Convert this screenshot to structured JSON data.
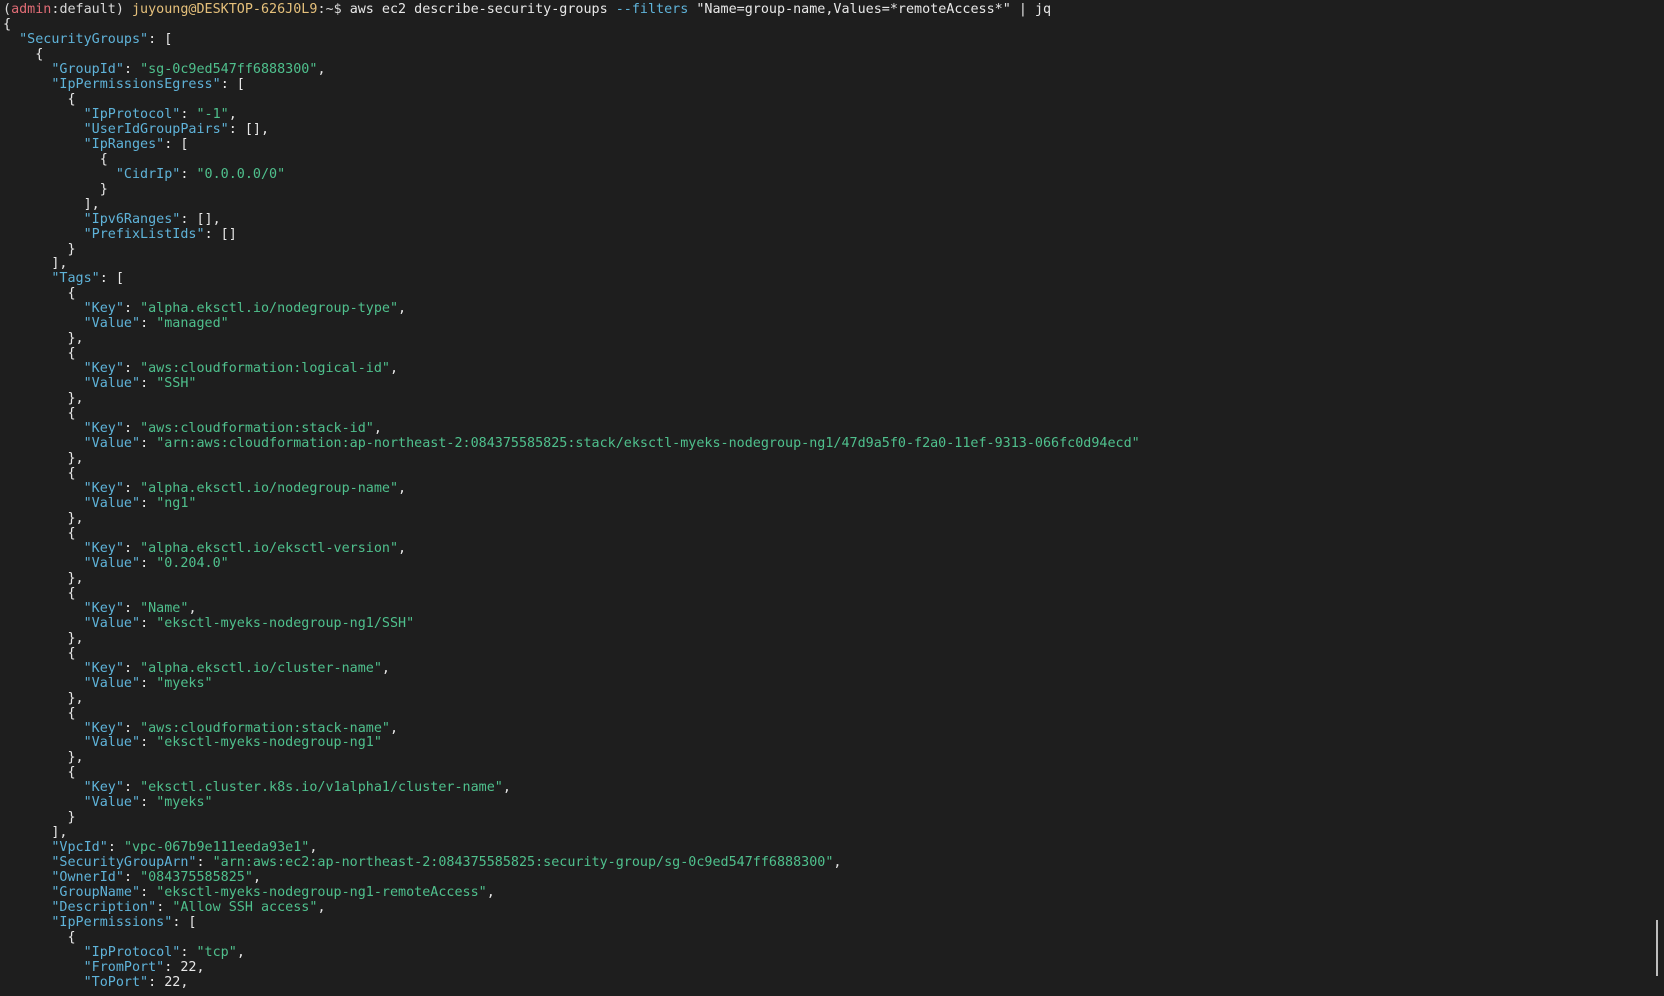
{
  "prompt": {
    "open_paren": "(",
    "env": "admin",
    "colon": ":",
    "profile": "default",
    "close_paren": ")",
    "user_host": "juyoung@DESKTOP-626J0L9",
    "path": ":~",
    "dollar": "$",
    "cmd_main": "aws ec2 describe-security-groups",
    "cmd_flag": "--filters",
    "cmd_arg": "\"Name=group-name,Values=*remoteAccess*\"",
    "cmd_pipe": "| jq"
  },
  "output_lines": [
    [
      [
        "w",
        "{"
      ]
    ],
    [
      [
        "w",
        "  "
      ],
      [
        "k",
        "\"SecurityGroups\""
      ],
      [
        "w",
        ": ["
      ]
    ],
    [
      [
        "w",
        "    {"
      ]
    ],
    [
      [
        "w",
        "      "
      ],
      [
        "k",
        "\"GroupId\""
      ],
      [
        "w",
        ": "
      ],
      [
        "s",
        "\"sg-0c9ed547ff6888300\""
      ],
      [
        "w",
        ","
      ]
    ],
    [
      [
        "w",
        "      "
      ],
      [
        "k",
        "\"IpPermissionsEgress\""
      ],
      [
        "w",
        ": ["
      ]
    ],
    [
      [
        "w",
        "        {"
      ]
    ],
    [
      [
        "w",
        "          "
      ],
      [
        "k",
        "\"IpProtocol\""
      ],
      [
        "w",
        ": "
      ],
      [
        "s",
        "\"-1\""
      ],
      [
        "w",
        ","
      ]
    ],
    [
      [
        "w",
        "          "
      ],
      [
        "k",
        "\"UserIdGroupPairs\""
      ],
      [
        "w",
        ": [],"
      ]
    ],
    [
      [
        "w",
        "          "
      ],
      [
        "k",
        "\"IpRanges\""
      ],
      [
        "w",
        ": ["
      ]
    ],
    [
      [
        "w",
        "            {"
      ]
    ],
    [
      [
        "w",
        "              "
      ],
      [
        "k",
        "\"CidrIp\""
      ],
      [
        "w",
        ": "
      ],
      [
        "s",
        "\"0.0.0.0/0\""
      ]
    ],
    [
      [
        "w",
        "            }"
      ]
    ],
    [
      [
        "w",
        "          ],"
      ]
    ],
    [
      [
        "w",
        "          "
      ],
      [
        "k",
        "\"Ipv6Ranges\""
      ],
      [
        "w",
        ": [],"
      ]
    ],
    [
      [
        "w",
        "          "
      ],
      [
        "k",
        "\"PrefixListIds\""
      ],
      [
        "w",
        ": []"
      ]
    ],
    [
      [
        "w",
        "        }"
      ]
    ],
    [
      [
        "w",
        "      ],"
      ]
    ],
    [
      [
        "w",
        "      "
      ],
      [
        "k",
        "\"Tags\""
      ],
      [
        "w",
        ": ["
      ]
    ],
    [
      [
        "w",
        "        {"
      ]
    ],
    [
      [
        "w",
        "          "
      ],
      [
        "k",
        "\"Key\""
      ],
      [
        "w",
        ": "
      ],
      [
        "s",
        "\"alpha.eksctl.io/nodegroup-type\""
      ],
      [
        "w",
        ","
      ]
    ],
    [
      [
        "w",
        "          "
      ],
      [
        "k",
        "\"Value\""
      ],
      [
        "w",
        ": "
      ],
      [
        "s",
        "\"managed\""
      ]
    ],
    [
      [
        "w",
        "        },"
      ]
    ],
    [
      [
        "w",
        "        {"
      ]
    ],
    [
      [
        "w",
        "          "
      ],
      [
        "k",
        "\"Key\""
      ],
      [
        "w",
        ": "
      ],
      [
        "s",
        "\"aws:cloudformation:logical-id\""
      ],
      [
        "w",
        ","
      ]
    ],
    [
      [
        "w",
        "          "
      ],
      [
        "k",
        "\"Value\""
      ],
      [
        "w",
        ": "
      ],
      [
        "s",
        "\"SSH\""
      ]
    ],
    [
      [
        "w",
        "        },"
      ]
    ],
    [
      [
        "w",
        "        {"
      ]
    ],
    [
      [
        "w",
        "          "
      ],
      [
        "k",
        "\"Key\""
      ],
      [
        "w",
        ": "
      ],
      [
        "s",
        "\"aws:cloudformation:stack-id\""
      ],
      [
        "w",
        ","
      ]
    ],
    [
      [
        "w",
        "          "
      ],
      [
        "k",
        "\"Value\""
      ],
      [
        "w",
        ": "
      ],
      [
        "s",
        "\"arn:aws:cloudformation:ap-northeast-2:084375585825:stack/eksctl-myeks-nodegroup-ng1/47d9a5f0-f2a0-11ef-9313-066fc0d94ecd\""
      ]
    ],
    [
      [
        "w",
        "        },"
      ]
    ],
    [
      [
        "w",
        "        {"
      ]
    ],
    [
      [
        "w",
        "          "
      ],
      [
        "k",
        "\"Key\""
      ],
      [
        "w",
        ": "
      ],
      [
        "s",
        "\"alpha.eksctl.io/nodegroup-name\""
      ],
      [
        "w",
        ","
      ]
    ],
    [
      [
        "w",
        "          "
      ],
      [
        "k",
        "\"Value\""
      ],
      [
        "w",
        ": "
      ],
      [
        "s",
        "\"ng1\""
      ]
    ],
    [
      [
        "w",
        "        },"
      ]
    ],
    [
      [
        "w",
        "        {"
      ]
    ],
    [
      [
        "w",
        "          "
      ],
      [
        "k",
        "\"Key\""
      ],
      [
        "w",
        ": "
      ],
      [
        "s",
        "\"alpha.eksctl.io/eksctl-version\""
      ],
      [
        "w",
        ","
      ]
    ],
    [
      [
        "w",
        "          "
      ],
      [
        "k",
        "\"Value\""
      ],
      [
        "w",
        ": "
      ],
      [
        "s",
        "\"0.204.0\""
      ]
    ],
    [
      [
        "w",
        "        },"
      ]
    ],
    [
      [
        "w",
        "        {"
      ]
    ],
    [
      [
        "w",
        "          "
      ],
      [
        "k",
        "\"Key\""
      ],
      [
        "w",
        ": "
      ],
      [
        "s",
        "\"Name\""
      ],
      [
        "w",
        ","
      ]
    ],
    [
      [
        "w",
        "          "
      ],
      [
        "k",
        "\"Value\""
      ],
      [
        "w",
        ": "
      ],
      [
        "s",
        "\"eksctl-myeks-nodegroup-ng1/SSH\""
      ]
    ],
    [
      [
        "w",
        "        },"
      ]
    ],
    [
      [
        "w",
        "        {"
      ]
    ],
    [
      [
        "w",
        "          "
      ],
      [
        "k",
        "\"Key\""
      ],
      [
        "w",
        ": "
      ],
      [
        "s",
        "\"alpha.eksctl.io/cluster-name\""
      ],
      [
        "w",
        ","
      ]
    ],
    [
      [
        "w",
        "          "
      ],
      [
        "k",
        "\"Value\""
      ],
      [
        "w",
        ": "
      ],
      [
        "s",
        "\"myeks\""
      ]
    ],
    [
      [
        "w",
        "        },"
      ]
    ],
    [
      [
        "w",
        "        {"
      ]
    ],
    [
      [
        "w",
        "          "
      ],
      [
        "k",
        "\"Key\""
      ],
      [
        "w",
        ": "
      ],
      [
        "s",
        "\"aws:cloudformation:stack-name\""
      ],
      [
        "w",
        ","
      ]
    ],
    [
      [
        "w",
        "          "
      ],
      [
        "k",
        "\"Value\""
      ],
      [
        "w",
        ": "
      ],
      [
        "s",
        "\"eksctl-myeks-nodegroup-ng1\""
      ]
    ],
    [
      [
        "w",
        "        },"
      ]
    ],
    [
      [
        "w",
        "        {"
      ]
    ],
    [
      [
        "w",
        "          "
      ],
      [
        "k",
        "\"Key\""
      ],
      [
        "w",
        ": "
      ],
      [
        "s",
        "\"eksctl.cluster.k8s.io/v1alpha1/cluster-name\""
      ],
      [
        "w",
        ","
      ]
    ],
    [
      [
        "w",
        "          "
      ],
      [
        "k",
        "\"Value\""
      ],
      [
        "w",
        ": "
      ],
      [
        "s",
        "\"myeks\""
      ]
    ],
    [
      [
        "w",
        "        }"
      ]
    ],
    [
      [
        "w",
        "      ],"
      ]
    ],
    [
      [
        "w",
        "      "
      ],
      [
        "k",
        "\"VpcId\""
      ],
      [
        "w",
        ": "
      ],
      [
        "s",
        "\"vpc-067b9e111eeda93e1\""
      ],
      [
        "w",
        ","
      ]
    ],
    [
      [
        "w",
        "      "
      ],
      [
        "k",
        "\"SecurityGroupArn\""
      ],
      [
        "w",
        ": "
      ],
      [
        "s",
        "\"arn:aws:ec2:ap-northeast-2:084375585825:security-group/sg-0c9ed547ff6888300\""
      ],
      [
        "w",
        ","
      ]
    ],
    [
      [
        "w",
        "      "
      ],
      [
        "k",
        "\"OwnerId\""
      ],
      [
        "w",
        ": "
      ],
      [
        "s",
        "\"084375585825\""
      ],
      [
        "w",
        ","
      ]
    ],
    [
      [
        "w",
        "      "
      ],
      [
        "k",
        "\"GroupName\""
      ],
      [
        "w",
        ": "
      ],
      [
        "s",
        "\"eksctl-myeks-nodegroup-ng1-remoteAccess\""
      ],
      [
        "w",
        ","
      ]
    ],
    [
      [
        "w",
        "      "
      ],
      [
        "k",
        "\"Description\""
      ],
      [
        "w",
        ": "
      ],
      [
        "s",
        "\"Allow SSH access\""
      ],
      [
        "w",
        ","
      ]
    ],
    [
      [
        "w",
        "      "
      ],
      [
        "k",
        "\"IpPermissions\""
      ],
      [
        "w",
        ": ["
      ]
    ],
    [
      [
        "w",
        "        {"
      ]
    ],
    [
      [
        "w",
        "          "
      ],
      [
        "k",
        "\"IpProtocol\""
      ],
      [
        "w",
        ": "
      ],
      [
        "s",
        "\"tcp\""
      ],
      [
        "w",
        ","
      ]
    ],
    [
      [
        "w",
        "          "
      ],
      [
        "k",
        "\"FromPort\""
      ],
      [
        "w",
        ": 22,"
      ]
    ],
    [
      [
        "w",
        "          "
      ],
      [
        "k",
        "\"ToPort\""
      ],
      [
        "w",
        ": 22,"
      ]
    ]
  ],
  "colors": {
    "background": "#1e1e1e",
    "key": "#5fb3d9",
    "string": "#4fc08d",
    "punct": "#e8e8e8",
    "env": "#e06c75",
    "user_host": "#e5c07b"
  }
}
